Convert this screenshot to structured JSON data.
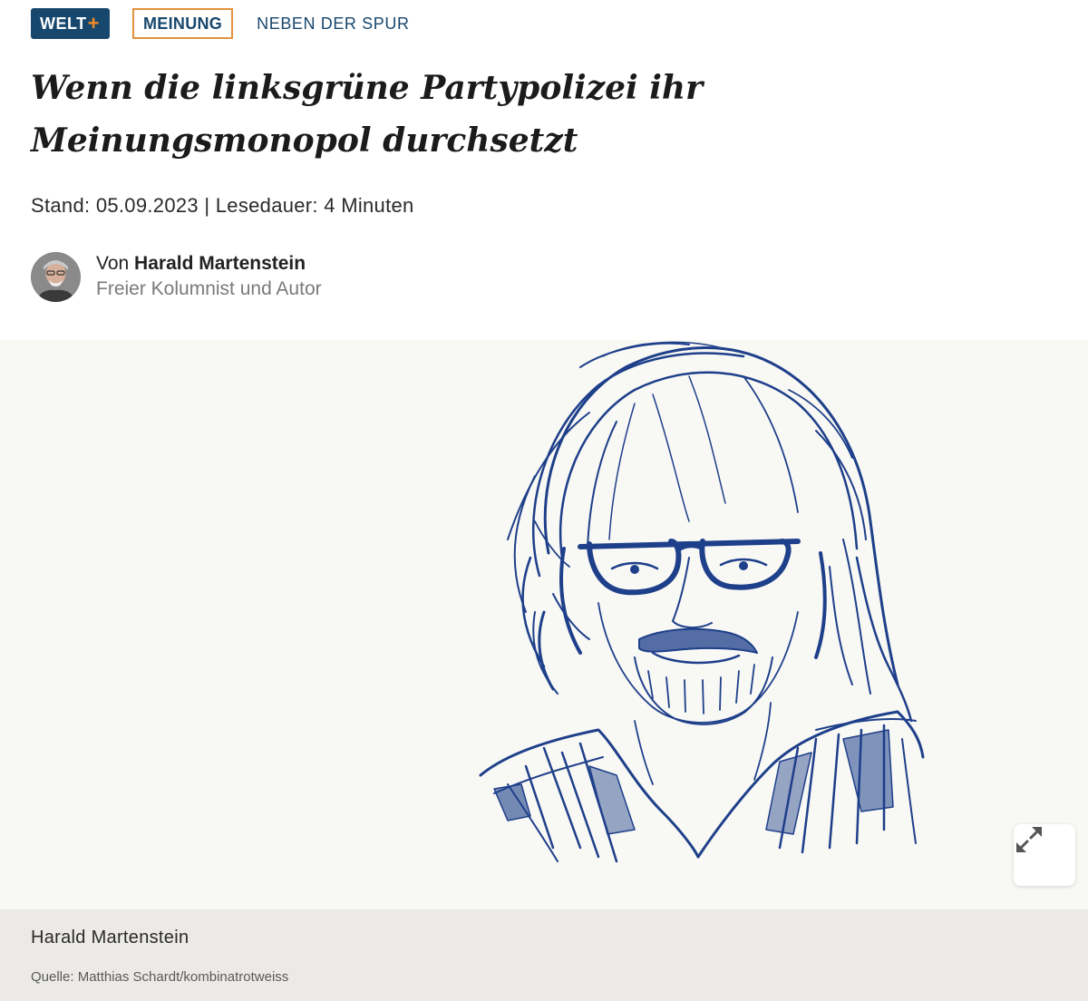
{
  "tags": {
    "welt_label": "WELT",
    "welt_plus": "+",
    "meinung_label": "MEINUNG",
    "rubrik_label": "NEBEN DER SPUR"
  },
  "article": {
    "headline": "Wenn die linksgrüne Partypolizei ihr Meinungsmonopol durchsetzt",
    "meta": "Stand: 05.09.2023 | Lesedauer: 4 Minuten"
  },
  "author": {
    "prefix": "Von ",
    "name": "Harald Martenstein",
    "role": "Freier Kolumnist und Autor"
  },
  "image": {
    "expand_icon": "expand-arrows-icon",
    "caption": "Harald Martenstein",
    "source": "Quelle: Matthias Schardt/kombinatrotweiss"
  },
  "colors": {
    "brand_blue": "#18476d",
    "accent_orange": "#e4913e",
    "sketch_blue": "#1e3f8a"
  }
}
